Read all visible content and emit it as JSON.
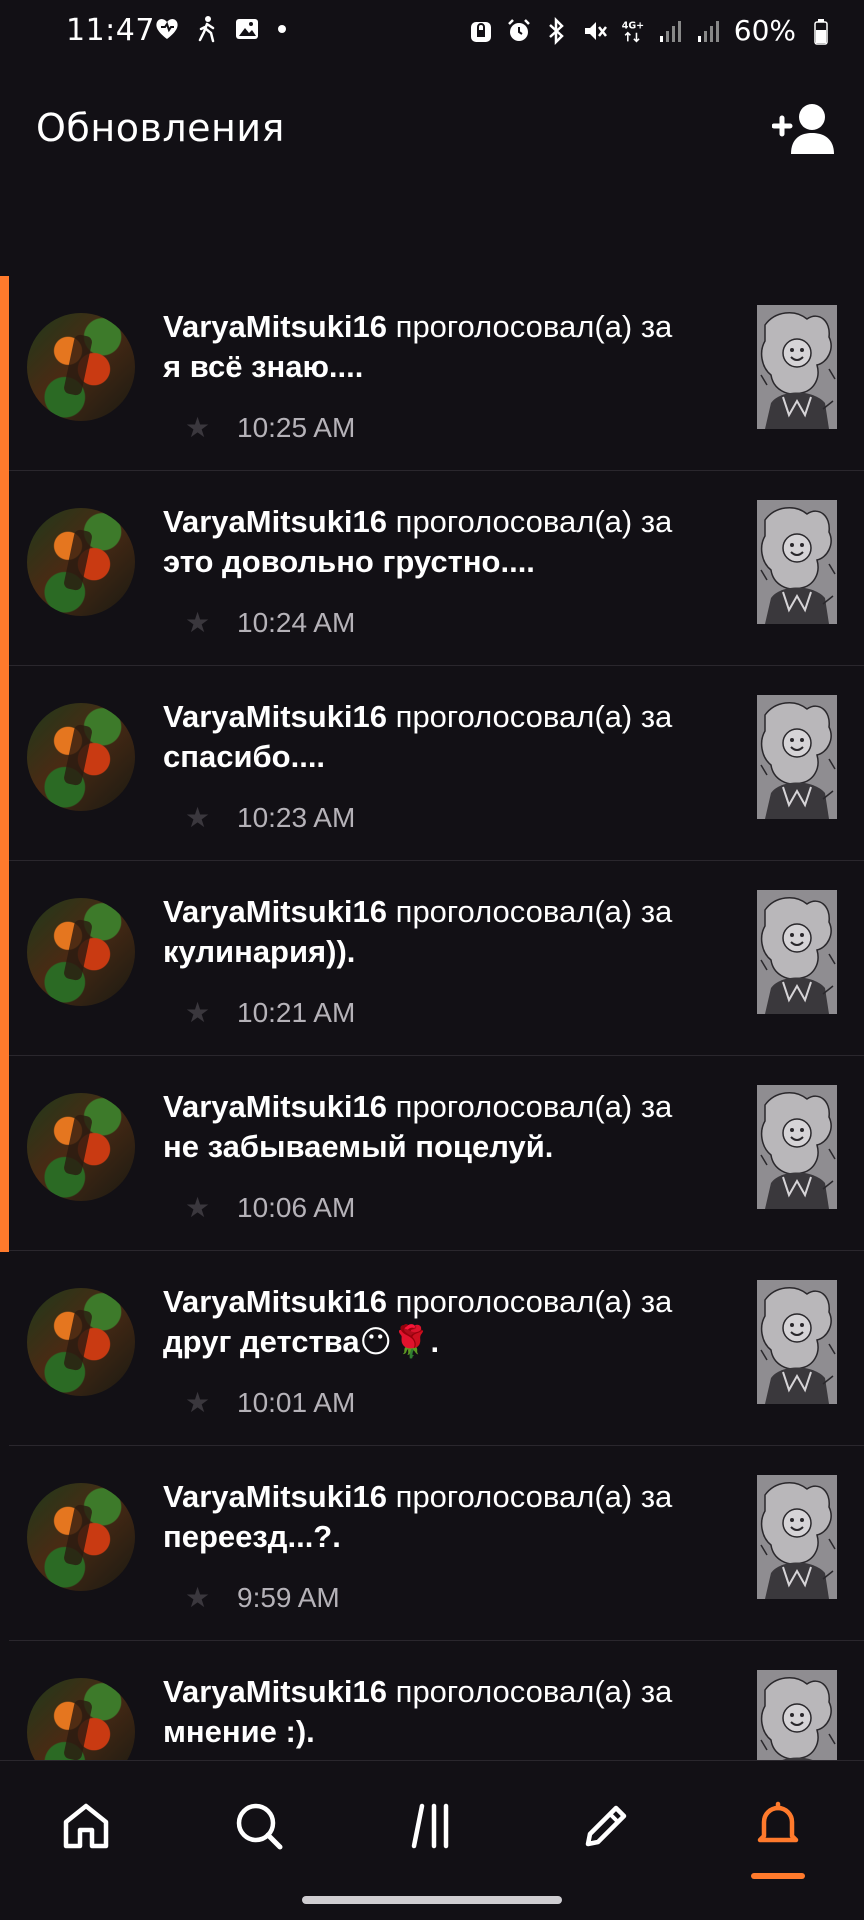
{
  "status_bar": {
    "time": "11:47",
    "battery": "60%",
    "network": "4G+"
  },
  "header": {
    "title": "Обновления",
    "add_friend_icon": "person-add-icon"
  },
  "notifications": [
    {
      "user": "VaryaMitsuki16",
      "verb": "проголосовал(а) за",
      "title": "я всё знаю....",
      "time": "10:25 AM",
      "unread": true
    },
    {
      "user": "VaryaMitsuki16",
      "verb": "проголосовал(а) за",
      "title": "это довольно грустно....",
      "time": "10:24 AM",
      "unread": true
    },
    {
      "user": "VaryaMitsuki16",
      "verb": "проголосовал(а) за",
      "title": "спасибо....",
      "time": "10:23 AM",
      "unread": true
    },
    {
      "user": "VaryaMitsuki16",
      "verb": "проголосовал(а) за",
      "title": "кулинария)).",
      "time": "10:21 AM",
      "unread": true
    },
    {
      "user": "VaryaMitsuki16",
      "verb": "проголосовал(а) за",
      "title": "не забываемый поцелуй.",
      "time": "10:06 AM",
      "unread": true
    },
    {
      "user": "VaryaMitsuki16",
      "verb": "проголосовал(а) за",
      "title": "друг детства😶🌹.",
      "time": "10:01 AM",
      "unread": false
    },
    {
      "user": "VaryaMitsuki16",
      "verb": "проголосовал(а) за",
      "title": "переезд...?.",
      "time": "9:59 AM",
      "unread": false
    },
    {
      "user": "VaryaMitsuki16",
      "verb": "проголосовал(а) за",
      "title": "мнение :).",
      "time": "",
      "unread": false
    }
  ],
  "bottom_nav": {
    "items": [
      "home-icon",
      "search-icon",
      "library-icon",
      "write-icon",
      "notifications-bell-icon"
    ],
    "active": "notifications-bell-icon"
  },
  "colors": {
    "background": "#121015",
    "accent": "#ff7a2c",
    "timestamp": "#b5b2b8"
  }
}
